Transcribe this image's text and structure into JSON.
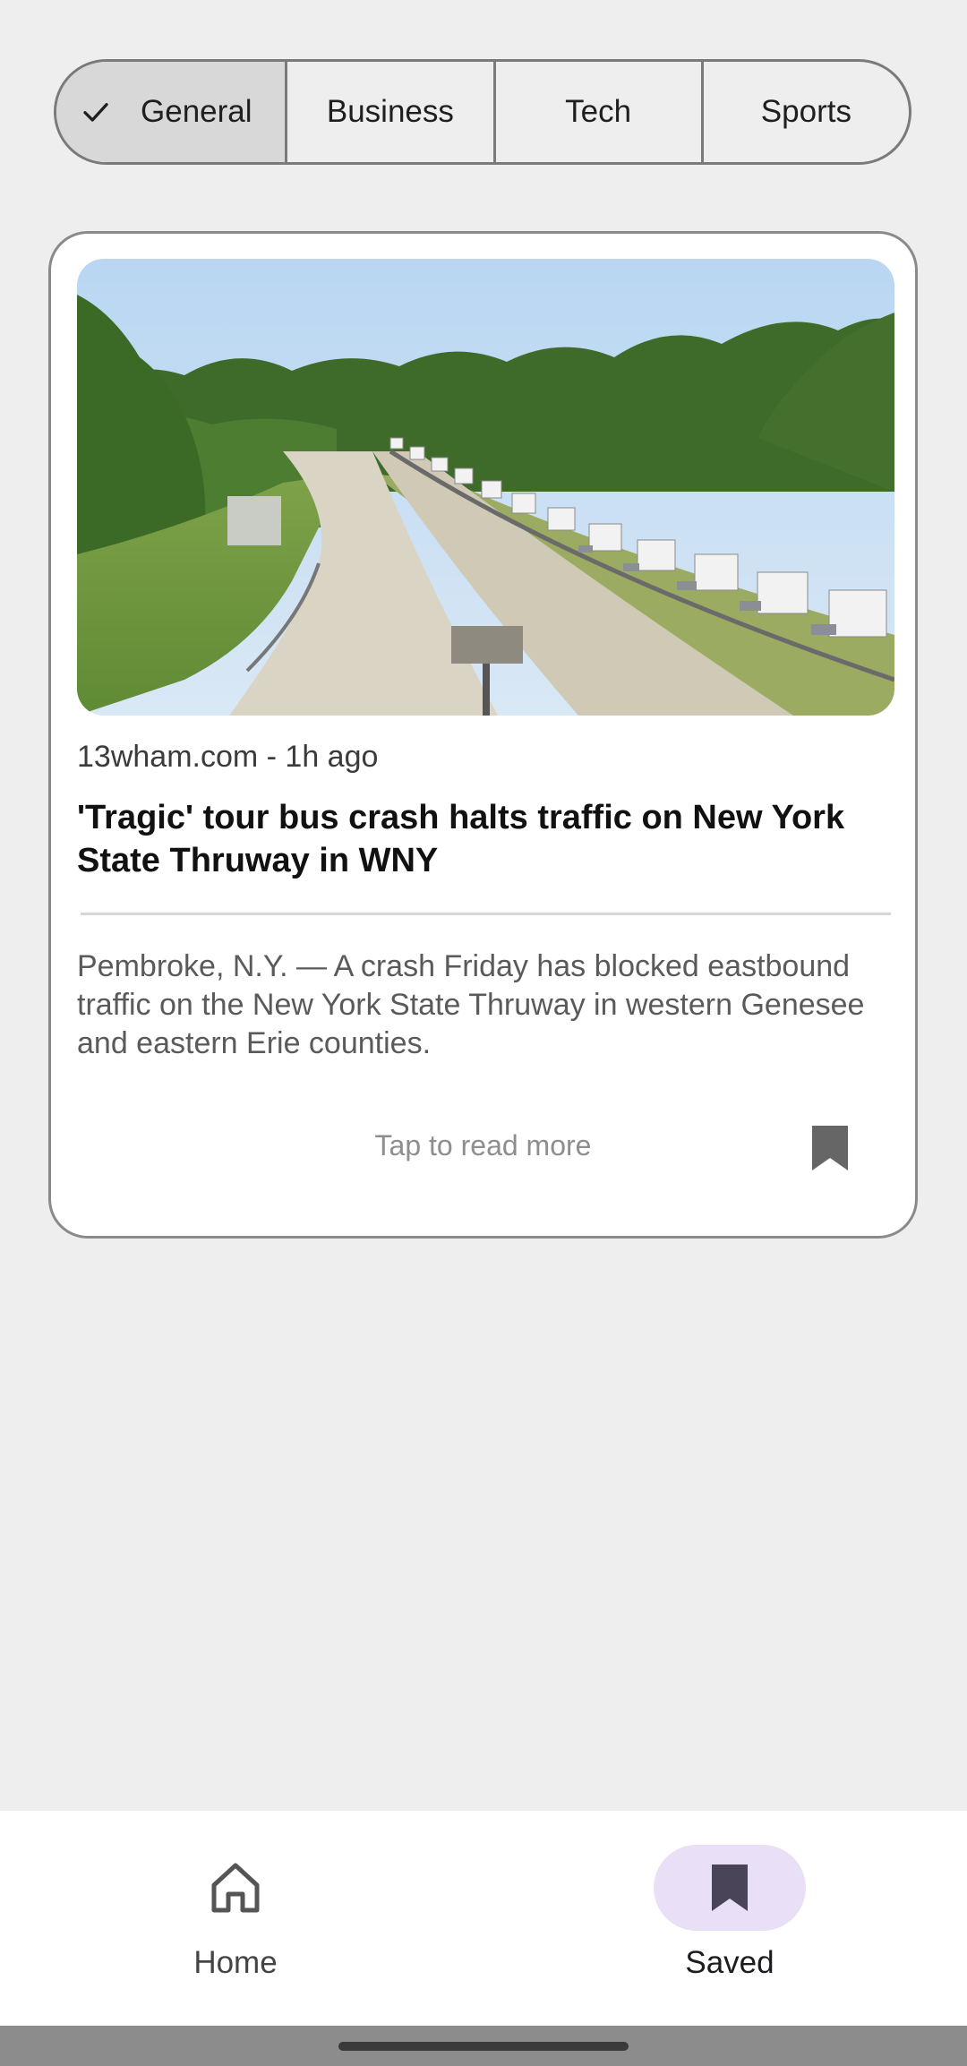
{
  "categories": {
    "items": [
      {
        "label": "General",
        "selected": true
      },
      {
        "label": "Business",
        "selected": false
      },
      {
        "label": "Tech",
        "selected": false
      },
      {
        "label": "Sports",
        "selected": false
      }
    ]
  },
  "article": {
    "source_line": "13wham.com - 1h ago",
    "headline": "'Tragic' tour bus crash halts traffic on New York State Thruway in WNY",
    "summary": "Pembroke, N.Y. — A crash Friday has blocked eastbound traffic on the New York State Thruway in western Genesee and eastern Erie counties.",
    "read_more": "Tap to read more",
    "saved": true
  },
  "bottom_nav": {
    "items": [
      {
        "label": "Home",
        "icon": "home-icon",
        "active": false
      },
      {
        "label": "Saved",
        "icon": "bookmark-icon",
        "active": true
      }
    ]
  },
  "colors": {
    "background": "#eeeeee",
    "card": "#ffffff",
    "segment_selected": "#d8d8d8",
    "nav_active_pill": "#e9dff6",
    "bookmark": "#666666"
  }
}
